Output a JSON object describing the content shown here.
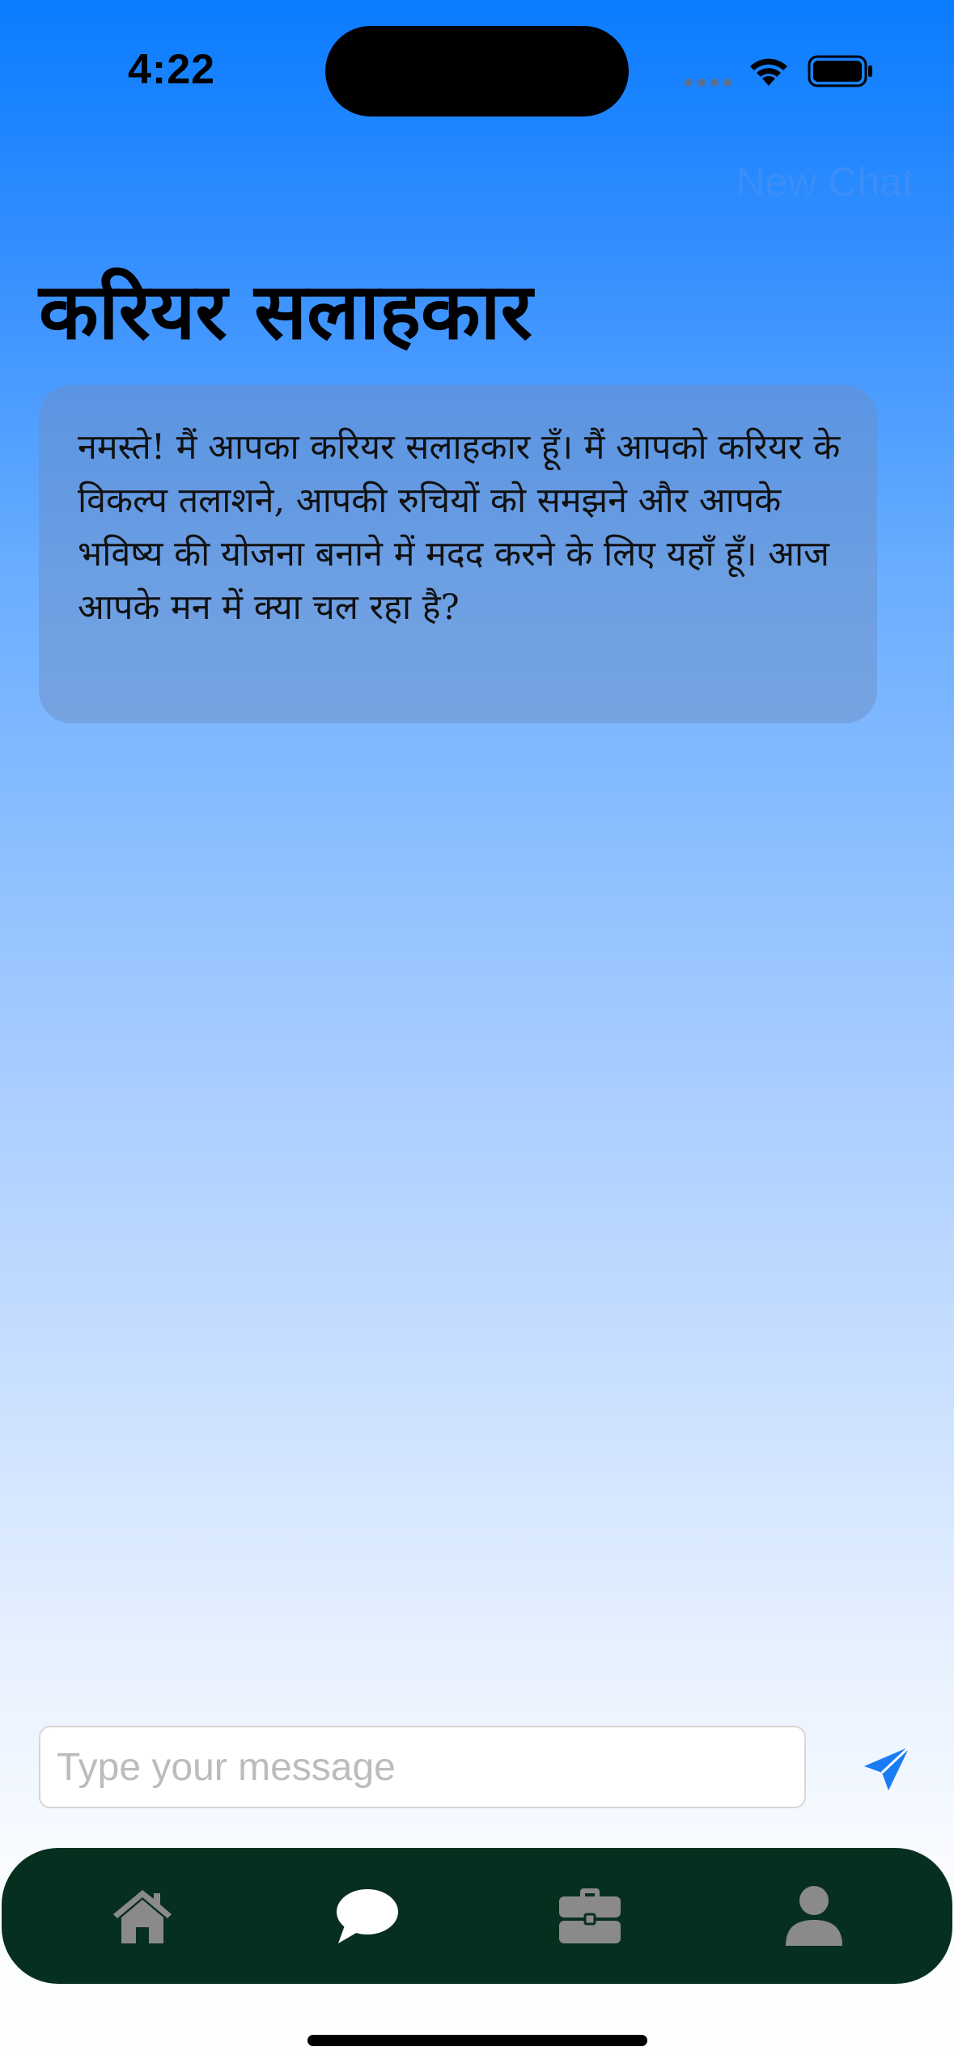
{
  "status_bar": {
    "time": "4:22",
    "icons": [
      "signal-dots-icon",
      "wifi-icon",
      "battery-icon"
    ]
  },
  "nav": {
    "new_chat_label": "New Chat"
  },
  "page": {
    "title": "करियर सलाहकार"
  },
  "messages": [
    {
      "role": "assistant",
      "text": "नमस्ते! मैं आपका करियर सलाहकार हूँ। मैं आपको करियर के विकल्प तलाशने, आपकी रुचियों को समझने और आपके भविष्य की योजना बनाने में मदद करने के लिए यहाँ हूँ। आज आपके मन में क्या चल रहा है?"
    }
  ],
  "composer": {
    "placeholder": "Type your message",
    "value": "",
    "send_icon": "send-icon"
  },
  "tab_bar": {
    "tabs": [
      {
        "icon": "home-icon"
      },
      {
        "icon": "chat-bubble-icon"
      },
      {
        "icon": "briefcase-icon"
      },
      {
        "icon": "person-icon"
      }
    ]
  },
  "colors": {
    "accent": "#0a7cff",
    "new_chat": "#3b8df7",
    "tab_bar_bg": "#062f1f",
    "tab_icon": "#8a8a8a",
    "tab_icon_active": "#ffffff",
    "send_icon": "#1a7cf5"
  }
}
